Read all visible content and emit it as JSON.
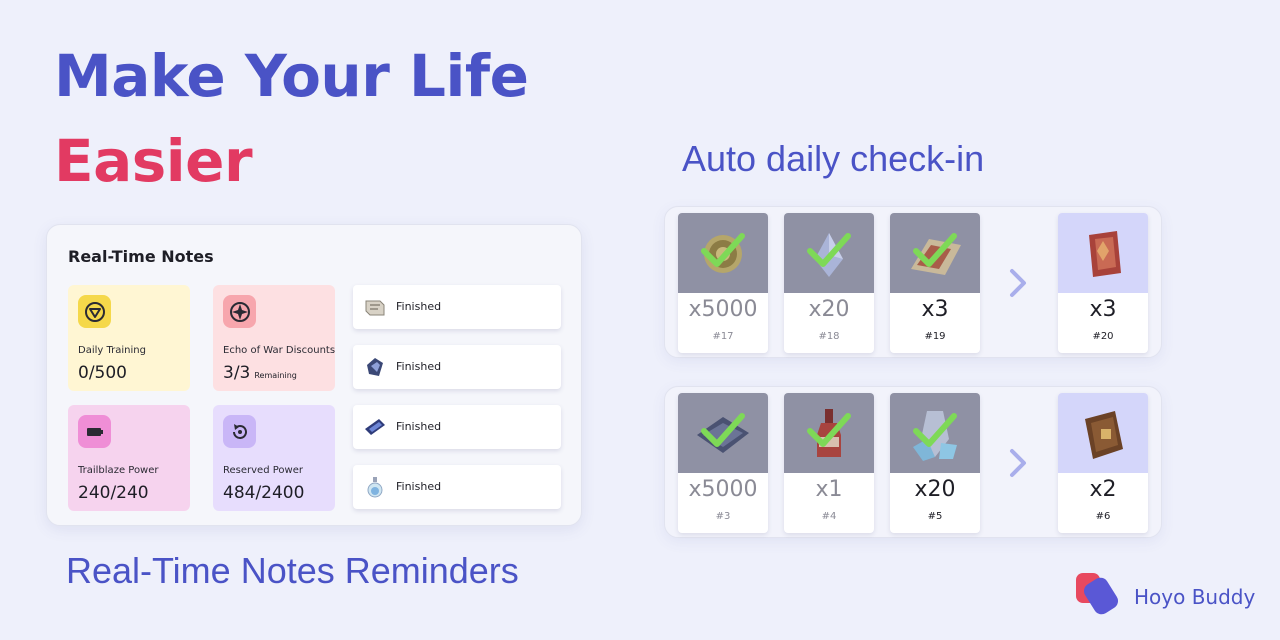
{
  "hero": {
    "line1": "Make Your Life",
    "line2": "Easier"
  },
  "checkin": {
    "title": "Auto daily check-in",
    "rows": [
      {
        "rewards": [
          {
            "qty": "x5000",
            "day": "#17",
            "state": "claimed",
            "item_icon": "credit-coin-icon"
          },
          {
            "qty": "x20",
            "day": "#18",
            "state": "claimed",
            "item_icon": "crystal-shard-icon"
          },
          {
            "qty": "x3",
            "day": "#19",
            "state": "claimed-today",
            "item_icon": "map-scroll-icon"
          }
        ],
        "next": {
          "qty": "x3",
          "day": "#20",
          "item_icon": "red-book-icon"
        }
      },
      {
        "rewards": [
          {
            "qty": "x5000",
            "day": "#3",
            "state": "claimed",
            "item_icon": "pass-cards-icon"
          },
          {
            "qty": "x1",
            "day": "#4",
            "state": "claimed",
            "item_icon": "bottle-icon"
          },
          {
            "qty": "x20",
            "day": "#5",
            "state": "claimed-today",
            "item_icon": "crystal-ore-icon"
          }
        ],
        "next": {
          "qty": "x2",
          "day": "#6",
          "item_icon": "brown-book-icon"
        }
      }
    ]
  },
  "notes": {
    "heading": "Real-Time Notes",
    "daily_training": {
      "label": "Daily Training",
      "value": "0/500",
      "color": "#fff6d3"
    },
    "echo_of_war": {
      "label": "Echo of War Discounts",
      "value": "3/3",
      "sub": "Remaining",
      "color": "#fde0e2"
    },
    "trailblaze_power": {
      "label": "Trailblaze Power",
      "value": "240/240",
      "color": "#f6d3ee"
    },
    "reserved_power": {
      "label": "Reserved Power",
      "value": "484/2400",
      "color": "#e7ddfd"
    },
    "expeditions": [
      {
        "status": "Finished",
        "icon": "scroll-relic-icon"
      },
      {
        "status": "Finished",
        "icon": "gauntlet-icon"
      },
      {
        "status": "Finished",
        "icon": "ticket-icon"
      },
      {
        "status": "Finished",
        "icon": "potion-icon"
      }
    ]
  },
  "footer": {
    "notes_title": "Real-Time Notes Reminders"
  },
  "brand": {
    "name": "Hoyo Buddy"
  },
  "colors": {
    "accent": "#4a53c6",
    "highlight": "#e23a62",
    "check": "#7ed957",
    "claimed_bg": "#8f91a4",
    "next_bg": "#d4d6fa"
  }
}
